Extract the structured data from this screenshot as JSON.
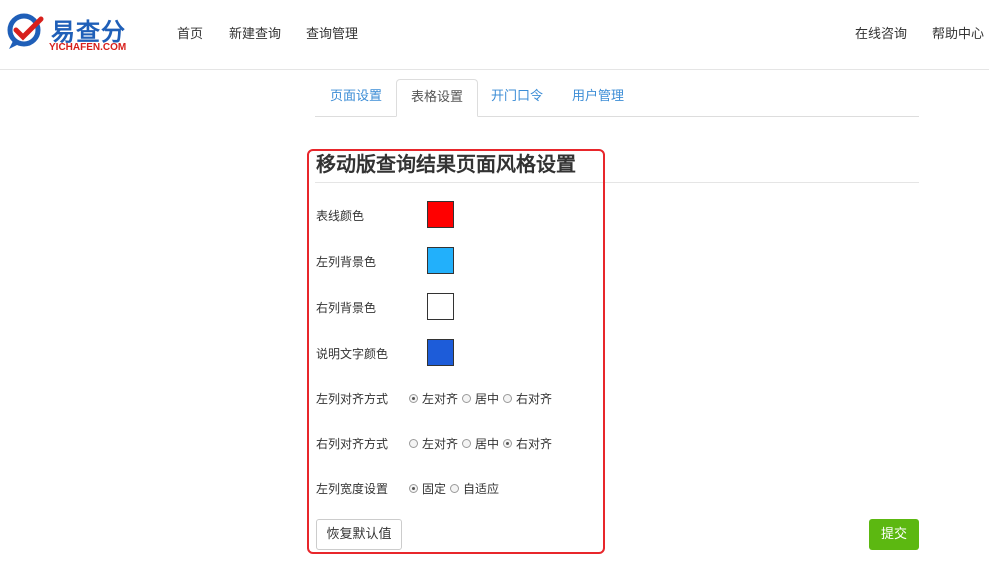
{
  "header": {
    "logo_text": "易查分",
    "logo_sub": "YICHAFEN.COM",
    "nav": [
      "首页",
      "新建查询",
      "查询管理"
    ],
    "right_nav": [
      "在线咨询",
      "帮助中心"
    ]
  },
  "tabs": [
    {
      "label": "页面设置",
      "active": false
    },
    {
      "label": "表格设置",
      "active": true
    },
    {
      "label": "开门口令",
      "active": false
    },
    {
      "label": "用户管理",
      "active": false
    }
  ],
  "section_title": "移动版查询结果页面风格设置",
  "colors": [
    {
      "label": "表线颜色",
      "value": "#ff0000"
    },
    {
      "label": "左列背景色",
      "value": "#22b0fb"
    },
    {
      "label": "右列背景色",
      "value": "#ffffff"
    },
    {
      "label": "说明文字颜色",
      "value": "#1d5cd9"
    }
  ],
  "options": [
    {
      "label": "左列对齐方式",
      "choices": [
        "左对齐",
        "居中",
        "右对齐"
      ],
      "selected": "左对齐"
    },
    {
      "label": "右列对齐方式",
      "choices": [
        "左对齐",
        "居中",
        "右对齐"
      ],
      "selected": "右对齐"
    },
    {
      "label": "左列宽度设置",
      "choices": [
        "固定",
        "自适应"
      ],
      "selected": "固定"
    }
  ],
  "buttons": {
    "reset": "恢复默认值",
    "submit": "提交"
  },
  "accent": {
    "link": "#3c8dd6",
    "submit": "#5cb811",
    "highlight": "#e8262b"
  }
}
